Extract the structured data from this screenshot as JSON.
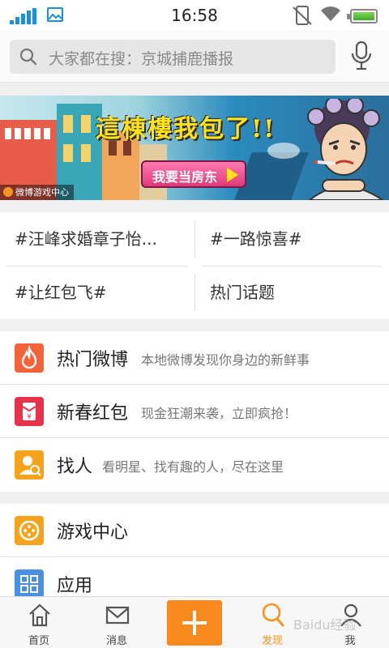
{
  "status_bar": {
    "time": "16:58",
    "battery_level": 1.0
  },
  "search": {
    "placeholder": "大家都在搜：京城捕鹿播报"
  },
  "banner": {
    "headline": "這棟樓我包了!!",
    "button_label": "我要当房东",
    "source_tag": "微博游戏中心"
  },
  "topics": [
    "#汪峰求婚章子怡...",
    "#一路惊喜#",
    "#让红包飞#",
    "热门话题"
  ],
  "discover": [
    {
      "title": "热门微博",
      "desc": "本地微博发现你身边的新鲜事",
      "icon": "flame-icon",
      "color": "#f4623a"
    },
    {
      "title": "新春红包",
      "desc": "现金狂潮来袭，立即疯抢！",
      "icon": "red-envelope-icon",
      "color": "#e8334a"
    },
    {
      "title": "找人",
      "desc": "看明星、找有趣的人，尽在这里",
      "icon": "find-people-icon",
      "color": "#f7a21b"
    }
  ],
  "apps": [
    {
      "title": "游戏中心",
      "icon": "gamepad-icon",
      "color": "#f7a21b"
    },
    {
      "title": "应用",
      "icon": "apps-grid-icon",
      "color": "#4a90e2"
    }
  ],
  "tabbar": [
    {
      "label": "首页",
      "icon": "home-icon"
    },
    {
      "label": "消息",
      "icon": "message-icon"
    },
    {
      "label": "",
      "icon": "compose-plus-icon"
    },
    {
      "label": "发现",
      "icon": "discover-icon",
      "active": true
    },
    {
      "label": "我",
      "icon": "profile-icon"
    }
  ],
  "watermark": "Baidu经验"
}
